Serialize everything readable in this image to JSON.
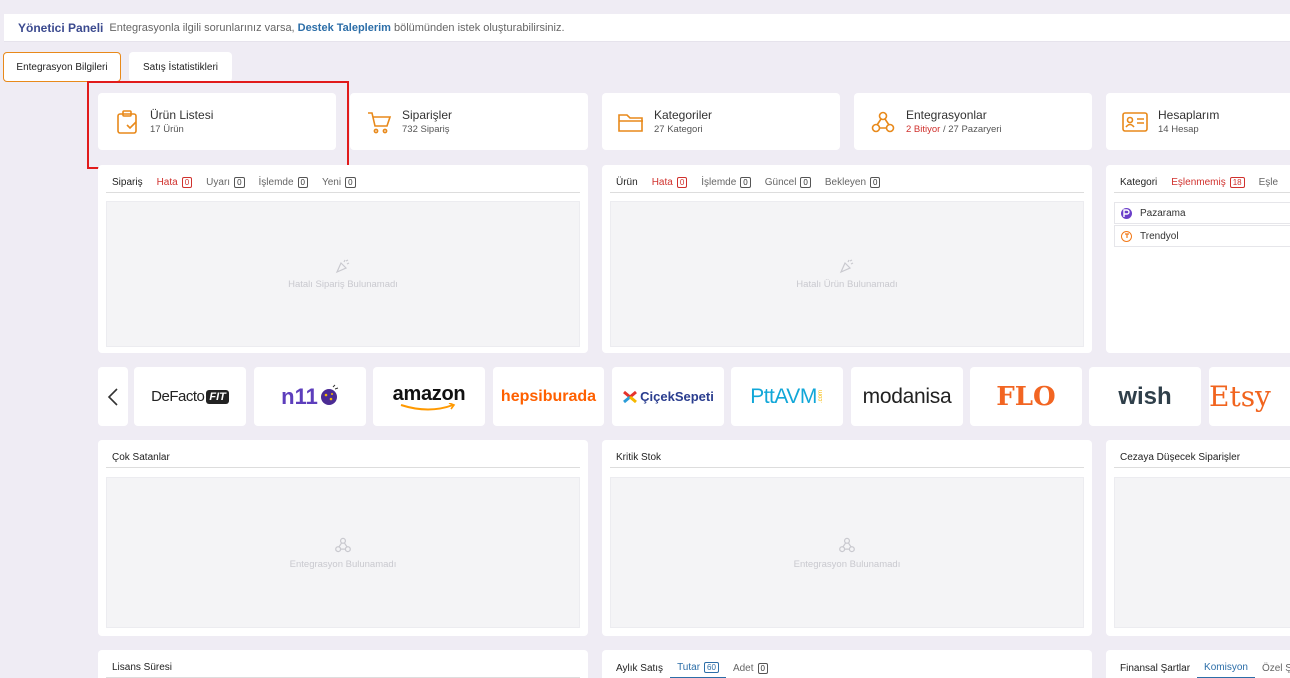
{
  "topbar": {
    "title": "Yönetici Paneli",
    "message_before": "Entegrasyonla ilgili sorunlarınız varsa,",
    "link": "Destek Taleplerim",
    "message_after": "bölümünden istek oluşturabilirsiniz."
  },
  "tabs": [
    {
      "label": "Entegrasyon Bilgileri",
      "active": true
    },
    {
      "label": "Satış İstatistikleri",
      "active": false
    }
  ],
  "stats": [
    {
      "label": "Ürün Listesi",
      "sub": "17 Ürün",
      "icon": "clipboard-check-icon"
    },
    {
      "label": "Siparişler",
      "sub": "732 Sipariş",
      "icon": "cart-icon"
    },
    {
      "label": "Kategoriler",
      "sub": "27 Kategori",
      "icon": "folder-icon"
    },
    {
      "label": "Entegrasyonlar",
      "sub_red": "2 Bitiyor",
      "sub_sep": " / ",
      "sub_rest": "27 Pazaryeri",
      "icon": "webhook-icon"
    },
    {
      "label": "Hesaplarım",
      "sub": "14 Hesap",
      "icon": "id-card-icon"
    }
  ],
  "order_panel": {
    "title": "Sipariş",
    "tabs": [
      {
        "label": "Hata",
        "count": "0"
      },
      {
        "label": "Uyarı",
        "count": "0"
      },
      {
        "label": "İşlemde",
        "count": "0"
      },
      {
        "label": "Yeni",
        "count": "0"
      }
    ],
    "empty": "Hatalı Sipariş Bulunamadı"
  },
  "product_panel": {
    "title": "Ürün",
    "tabs": [
      {
        "label": "Hata",
        "count": "0"
      },
      {
        "label": "İşlemde",
        "count": "0"
      },
      {
        "label": "Güncel",
        "count": "0"
      },
      {
        "label": "Bekleyen",
        "count": "0"
      }
    ],
    "empty": "Hatalı Ürün Bulunamadı"
  },
  "category_panel": {
    "title": "Kategori",
    "tabs": [
      {
        "label": "Eşlenmemiş",
        "count": "18"
      },
      {
        "label": "Eşle"
      }
    ],
    "items": [
      "Pazarama",
      "Trendyol"
    ]
  },
  "marketplaces": [
    {
      "name": "DeFacto FIT",
      "text": "DeFacto",
      "badge": "FIT"
    },
    {
      "name": "n11",
      "text": "n11"
    },
    {
      "name": "amazon",
      "text": "amazon"
    },
    {
      "name": "hepsiburada",
      "text": "hepsiburada"
    },
    {
      "name": "ÇiçekSepeti",
      "text": "ÇiçekSepeti"
    },
    {
      "name": "PttAVM",
      "text": "PttAVM",
      "suffix": ".com"
    },
    {
      "name": "modanisa",
      "text": "modanisa"
    },
    {
      "name": "FLO",
      "text": "FLO"
    },
    {
      "name": "wish",
      "text": "wish"
    },
    {
      "name": "Etsy",
      "text": "Etsy"
    }
  ],
  "best_sellers": {
    "title": "Çok Satanlar",
    "empty": "Entegrasyon Bulunamadı"
  },
  "critical_stock": {
    "title": "Kritik Stok",
    "empty": "Entegrasyon Bulunamadı"
  },
  "penalty_orders": {
    "title": "Cezaya Düşecek Siparişler"
  },
  "license": {
    "title": "Lisans Süresi"
  },
  "monthly_sales": {
    "title": "Aylık Satış",
    "tabs": [
      {
        "label": "Tutar",
        "count": "60"
      },
      {
        "label": "Adet",
        "count": "0"
      }
    ]
  },
  "financial": {
    "title": "Finansal Şartlar",
    "tabs": [
      {
        "label": "Komisyon"
      },
      {
        "label": "Özel Şa"
      }
    ]
  },
  "colors": {
    "accent_orange": "#e8891a",
    "error_red": "#d0312d",
    "link_blue": "#2c6ea8",
    "highlight_red": "#e11b1b"
  }
}
